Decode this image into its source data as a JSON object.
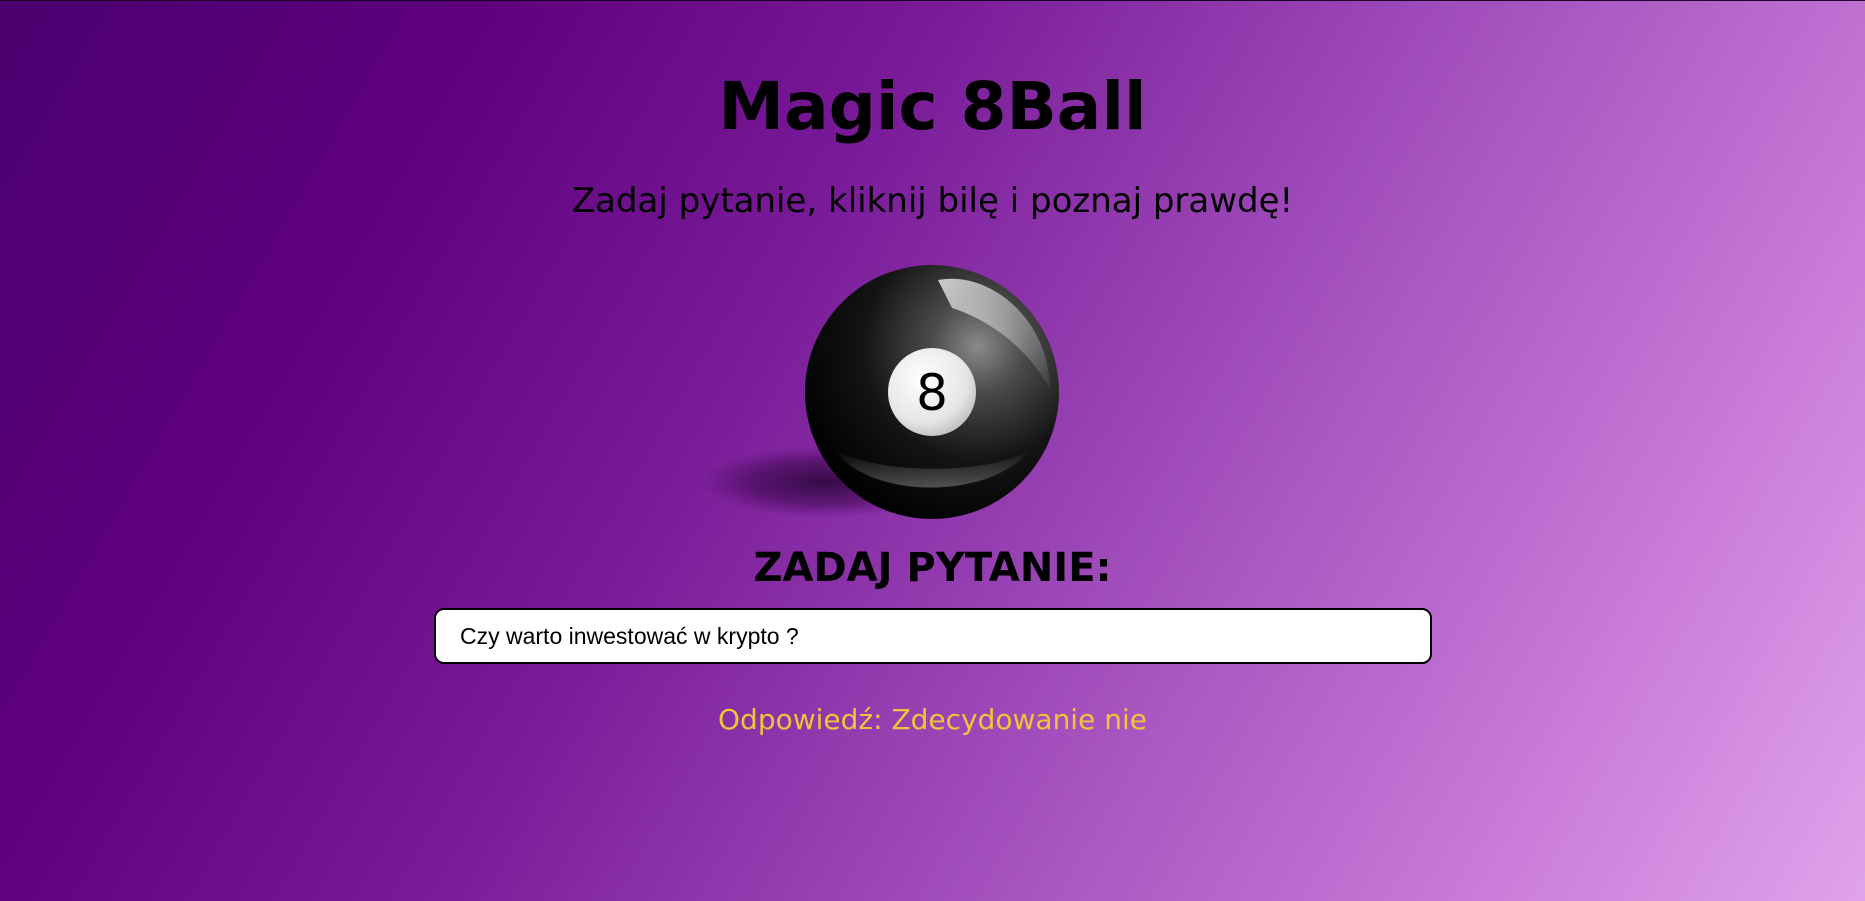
{
  "header": {
    "title": "Magic 8Ball",
    "subtitle": "Zadaj pytanie, kliknij bilę i poznaj prawdę!"
  },
  "ball": {
    "number": "8",
    "icon": "eight-ball-icon"
  },
  "question": {
    "heading": "ZADAJ PYTANIE:",
    "value": "Czy warto inwestować w krypto ?"
  },
  "answer": {
    "label": "Odpowiedź:",
    "text": "Zdecydowanie nie"
  },
  "colors": {
    "answer": "#f2c23a",
    "background_start": "#4a006f",
    "background_end": "#e0a3ec"
  }
}
